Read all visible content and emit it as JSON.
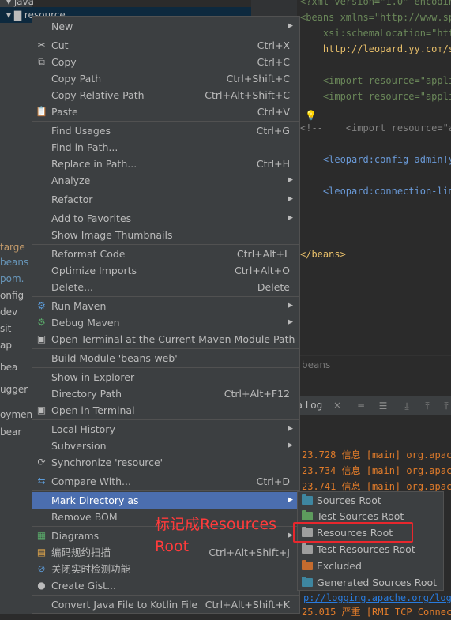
{
  "project_tree": {
    "top_items": [
      "java",
      "resource"
    ],
    "side_items": [
      "targe",
      "beans",
      "pom.",
      "onfig",
      "dev",
      "sit",
      "ap",
      "bea",
      "ugger",
      "oyment",
      "bear"
    ]
  },
  "editor": {
    "lines": [
      {
        "t": "<?xml version=\"1.0\" encoding"
      },
      {
        "t": "<beans xmlns=\"http://www.spr"
      },
      {
        "t": "    xsi:schemaLocation=\"http"
      },
      {
        "t": "    http://leopard.yy.com/sc"
      },
      {
        "t": ""
      },
      {
        "t": "    <import resource=\"applic"
      },
      {
        "t": "    <import resource=\"applic"
      },
      {
        "t": ""
      },
      {
        "t": "<!--    <import resource=\"ap"
      },
      {
        "t": ""
      },
      {
        "t": "    <leopard:config adminTyp"
      },
      {
        "t": ""
      },
      {
        "t": "    <leopard:connection-limi"
      },
      {
        "t": ""
      },
      {
        "t": ""
      },
      {
        "t": ""
      },
      {
        "t": "</beans>"
      }
    ],
    "breadcrumb": "beans"
  },
  "log": {
    "tab_label": "na Log",
    "lines": [
      "23.728 信息 [main] org.apac",
      "23.734 信息 [main] org.apac",
      "23.741 信息 [main] org.apac"
    ],
    "link_line": "p://logging.apache.org/log4",
    "last_line": "25.015 严重 [RMI TCP Connec"
  },
  "context_menu": {
    "items": [
      {
        "label": "New",
        "shortcut": "",
        "submenu": true
      },
      {
        "label": "Cut",
        "shortcut": "Ctrl+X",
        "icon": "scissors-icon"
      },
      {
        "label": "Copy",
        "shortcut": "Ctrl+C",
        "icon": "copy-icon"
      },
      {
        "label": "Copy Path",
        "shortcut": "Ctrl+Shift+C"
      },
      {
        "label": "Copy Relative Path",
        "shortcut": "Ctrl+Alt+Shift+C"
      },
      {
        "label": "Paste",
        "shortcut": "Ctrl+V",
        "icon": "paste-icon"
      },
      {
        "label": "Find Usages",
        "shortcut": "Ctrl+G"
      },
      {
        "label": "Find in Path...",
        "shortcut": ""
      },
      {
        "label": "Replace in Path...",
        "shortcut": "Ctrl+H"
      },
      {
        "label": "Analyze",
        "shortcut": "",
        "submenu": true
      },
      {
        "label": "Refactor",
        "shortcut": "",
        "submenu": true
      },
      {
        "label": "Add to Favorites",
        "shortcut": "",
        "submenu": true
      },
      {
        "label": "Show Image Thumbnails",
        "shortcut": ""
      },
      {
        "label": "Reformat Code",
        "shortcut": "Ctrl+Alt+L"
      },
      {
        "label": "Optimize Imports",
        "shortcut": "Ctrl+Alt+O"
      },
      {
        "label": "Delete...",
        "shortcut": "Delete"
      },
      {
        "label": "Run Maven",
        "shortcut": "",
        "submenu": true,
        "icon": "gear-icon"
      },
      {
        "label": "Debug Maven",
        "shortcut": "",
        "submenu": true,
        "icon": "debug-gear-icon"
      },
      {
        "label": "Open Terminal at the Current Maven Module Path",
        "shortcut": "",
        "icon": "terminal-icon"
      },
      {
        "label": "Build Module 'beans-web'",
        "shortcut": ""
      },
      {
        "label": "Show in Explorer",
        "shortcut": ""
      },
      {
        "label": "Directory Path",
        "shortcut": "Ctrl+Alt+F12"
      },
      {
        "label": "Open in Terminal",
        "shortcut": "",
        "icon": "terminal-icon"
      },
      {
        "label": "Local History",
        "shortcut": "",
        "submenu": true
      },
      {
        "label": "Subversion",
        "shortcut": "",
        "submenu": true
      },
      {
        "label": "Synchronize 'resource'",
        "shortcut": "",
        "icon": "sync-icon"
      },
      {
        "label": "Compare With...",
        "shortcut": "Ctrl+D",
        "icon": "compare-icon"
      },
      {
        "label": "Mark Directory as",
        "shortcut": "",
        "submenu": true
      },
      {
        "label": "Remove BOM",
        "shortcut": ""
      },
      {
        "label": "Diagrams",
        "shortcut": "",
        "submenu": true,
        "icon": "diagram-icon"
      },
      {
        "label": "编码规约扫描",
        "shortcut": "Ctrl+Alt+Shift+J",
        "icon": "scan-icon"
      },
      {
        "label": "关闭实时检测功能",
        "shortcut": "",
        "icon": "forbidden-icon"
      },
      {
        "label": "Create Gist...",
        "shortcut": "",
        "icon": "github-icon"
      },
      {
        "label": "Convert Java File to Kotlin File",
        "shortcut": "Ctrl+Alt+Shift+K"
      }
    ]
  },
  "submenu": {
    "items": [
      {
        "label": "Sources Root",
        "color": "#3e86a0"
      },
      {
        "label": "Test Sources Root",
        "color": "#5d9b5d"
      },
      {
        "label": "Resources Root",
        "color": "#9e9e9e"
      },
      {
        "label": "Test Resources Root",
        "color": "#9e9e9e"
      },
      {
        "label": "Excluded",
        "color": "#c46b2e"
      },
      {
        "label": "Generated Sources Root",
        "color": "#3e86a0"
      }
    ]
  },
  "annotation": {
    "text": "标记成Resources Root",
    "color": "#ff3b3b"
  }
}
